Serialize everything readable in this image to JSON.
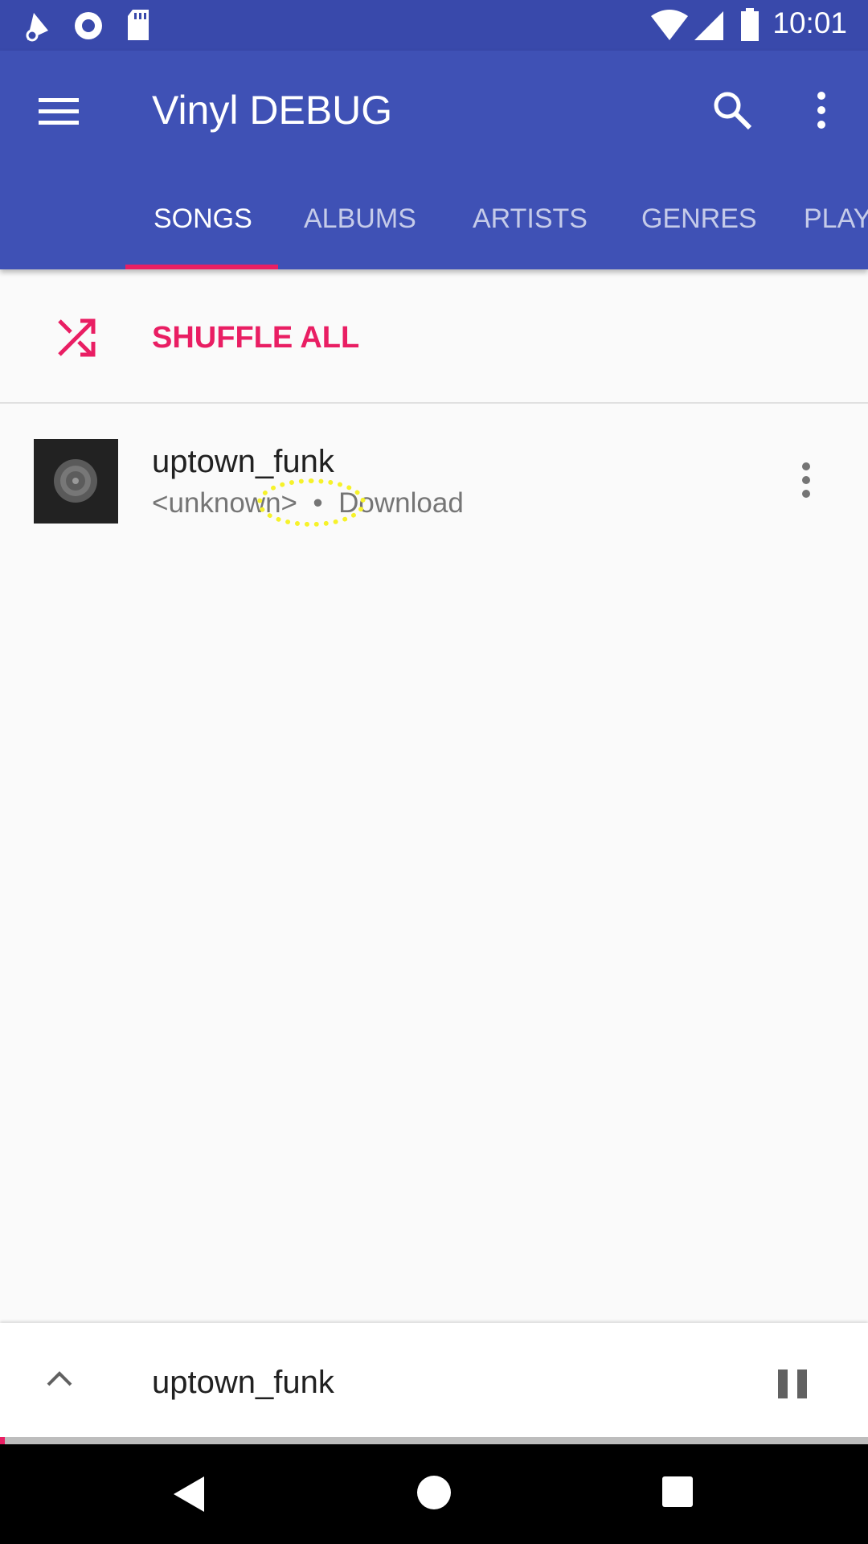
{
  "status_bar": {
    "time": "10:01",
    "icons": [
      "notification-triangle-icon",
      "radio-icon",
      "sd-card-icon",
      "wifi-icon",
      "signal-icon",
      "battery-icon"
    ]
  },
  "app_bar": {
    "title": "Vinyl DEBUG",
    "icons": [
      "menu-icon",
      "search-icon",
      "more-vert-icon"
    ],
    "tabs": [
      {
        "label": "SONGS",
        "active": true
      },
      {
        "label": "ALBUMS",
        "active": false
      },
      {
        "label": "ARTISTS",
        "active": false
      },
      {
        "label": "GENRES",
        "active": false
      },
      {
        "label": "PLAY",
        "active": false
      }
    ]
  },
  "shuffle": {
    "label": "SHUFFLE ALL",
    "icon": "shuffle-icon"
  },
  "songs": [
    {
      "title": "uptown_funk",
      "subtitle": "<unknown>  •  Download",
      "art_icon": "vinyl-record-icon"
    }
  ],
  "mini_player": {
    "title": "uptown_funk",
    "progress": 0.006,
    "icons": [
      "expand-up-icon",
      "pause-icon"
    ]
  },
  "nav_bar": {
    "icons": [
      "back-icon",
      "home-icon",
      "recents-icon"
    ]
  },
  "colors": {
    "primary": "#3F51B5",
    "primary_dark": "#3949AB",
    "accent": "#E91E63",
    "background": "#FAFAFA"
  }
}
